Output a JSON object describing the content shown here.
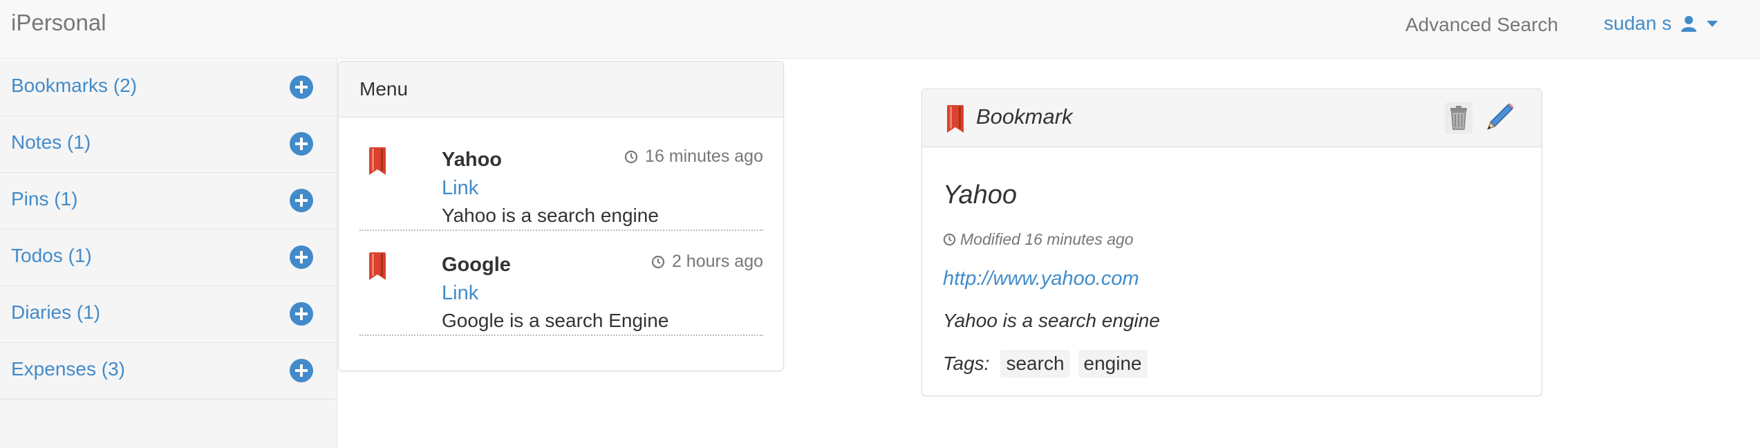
{
  "navbar": {
    "brand": "iPersonal",
    "advanced_search": "Advanced Search",
    "user_name": "sudan s"
  },
  "sidebar": {
    "items": [
      {
        "label": "Bookmarks (2)",
        "icon": "plus-circle-icon"
      },
      {
        "label": "Notes (1)",
        "icon": "plus-circle-icon"
      },
      {
        "label": "Pins (1)",
        "icon": "plus-circle-icon"
      },
      {
        "label": "Todos (1)",
        "icon": "plus-circle-icon"
      },
      {
        "label": "Diaries (1)",
        "icon": "plus-circle-icon"
      },
      {
        "label": "Expenses (3)",
        "icon": "plus-circle-icon"
      }
    ]
  },
  "list_panel": {
    "heading": "Menu",
    "entries": [
      {
        "title": "Yahoo",
        "link_label": "Link",
        "description": "Yahoo is a search engine",
        "time": "16 minutes ago"
      },
      {
        "title": "Google",
        "link_label": "Link",
        "description": "Google is a search Engine",
        "time": "2 hours ago"
      }
    ]
  },
  "detail": {
    "heading": "Bookmark",
    "title": "Yahoo",
    "modified": "Modified 16 minutes ago",
    "url": "http://www.yahoo.com",
    "description": "Yahoo is a search engine",
    "tags_label": "Tags:",
    "tags": [
      "search",
      "engine"
    ]
  },
  "colors": {
    "accent": "#428bca",
    "bookmark_red": "#d9432f",
    "navbar_bg": "#f8f8f8",
    "sidebar_bg": "#f5f5f5"
  }
}
